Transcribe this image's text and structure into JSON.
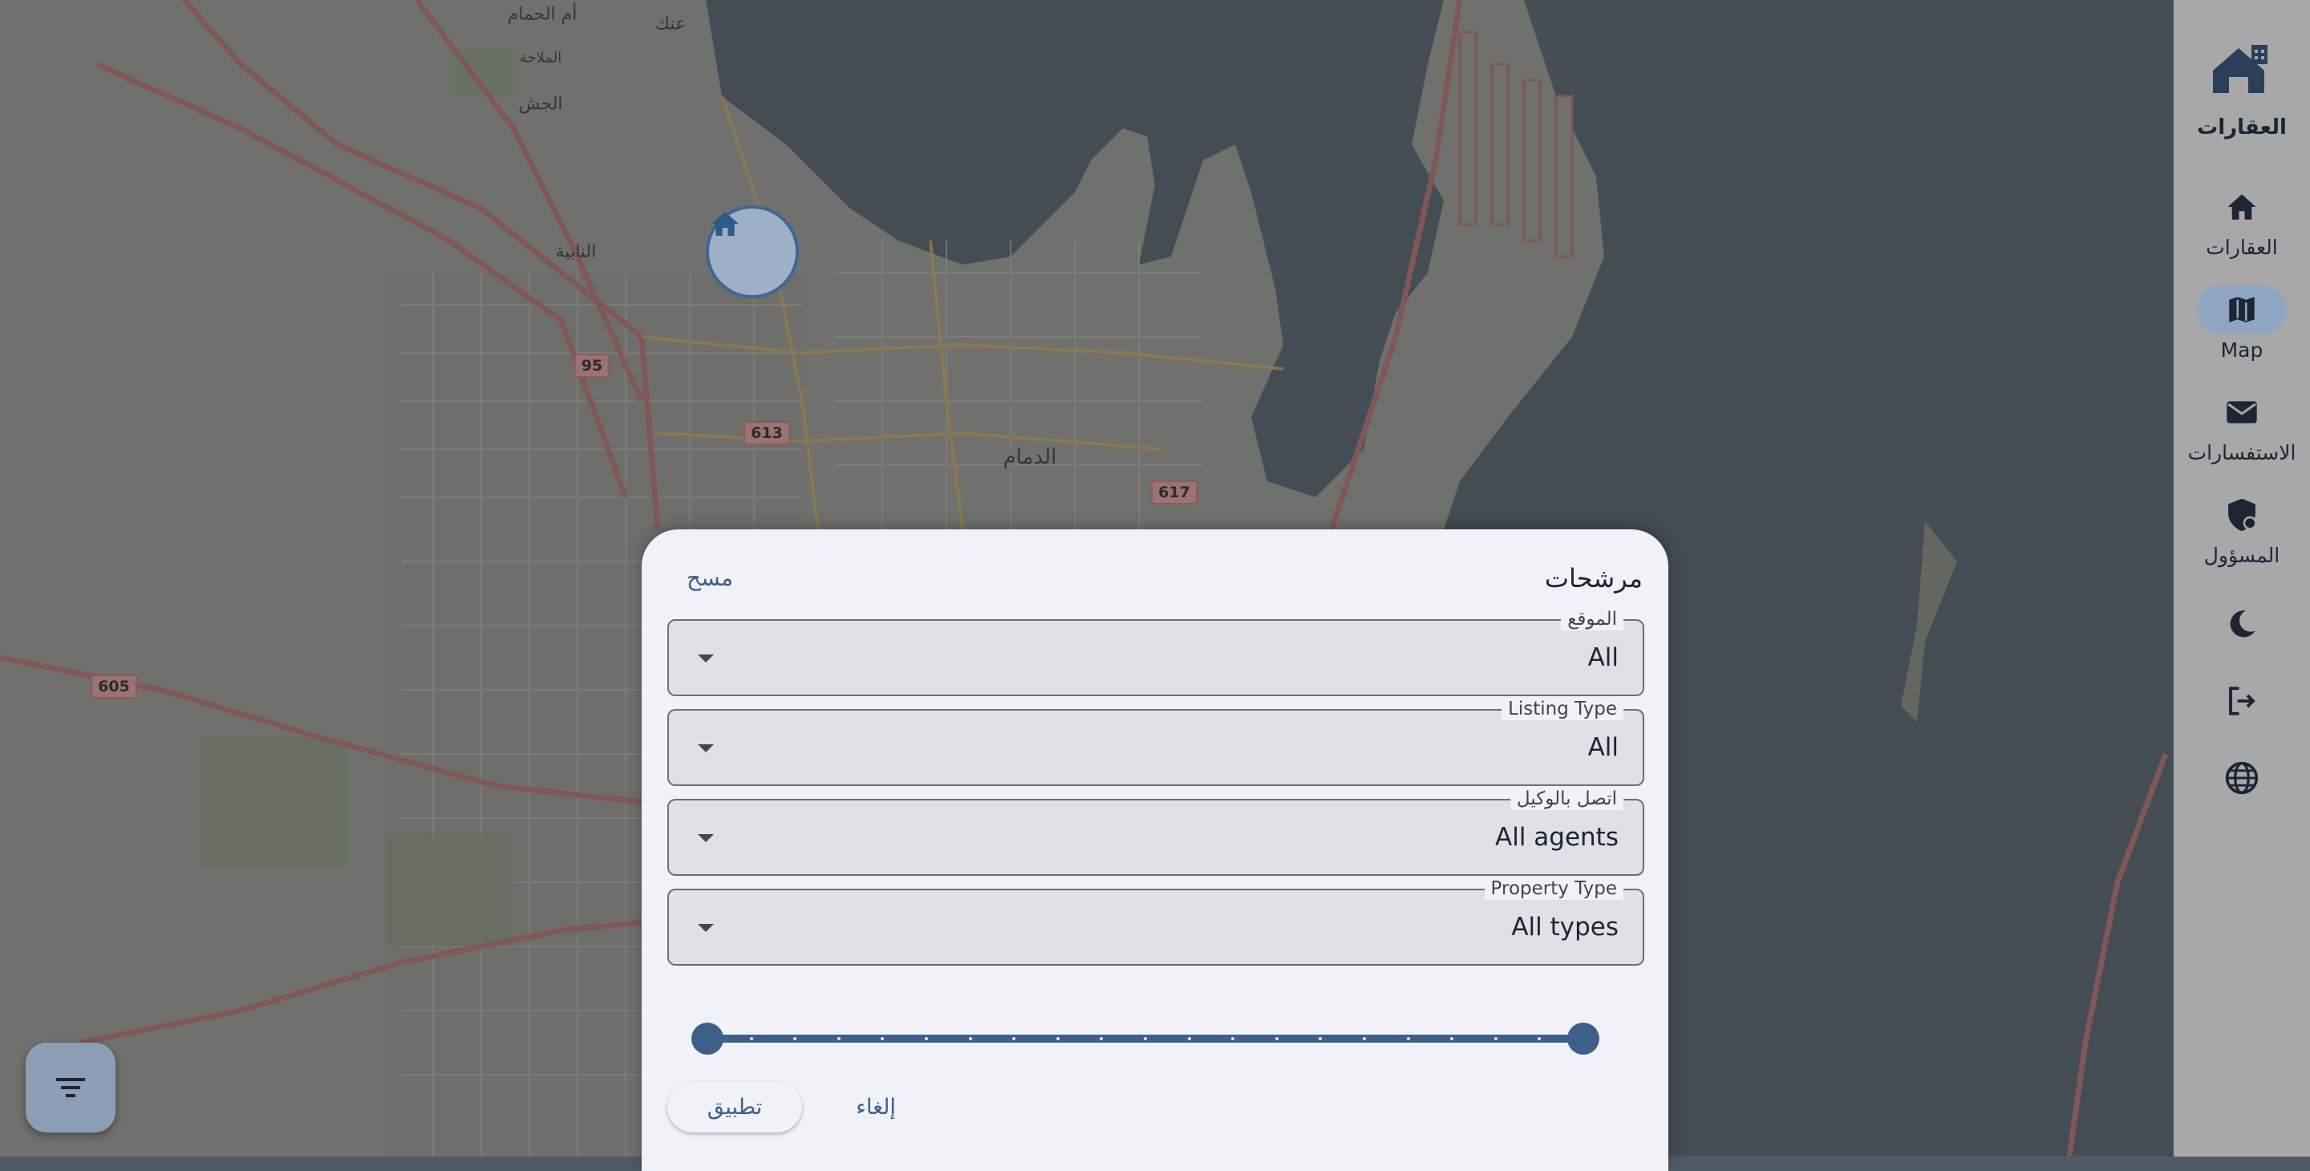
{
  "map": {
    "place_labels": [
      {
        "text": "أم الحمام",
        "name": "map-label-umm-alhamam"
      },
      {
        "text": "عنك",
        "name": "map-label-anak"
      },
      {
        "text": "الملاحة",
        "name": "map-label-almalaha"
      },
      {
        "text": "الجش",
        "name": "map-label-aljish"
      },
      {
        "text": "النابية",
        "name": "map-label-alnabiya"
      },
      {
        "text": "الدمام",
        "name": "map-label-dammam"
      }
    ],
    "road_shields": [
      "95",
      "613",
      "617",
      "605"
    ]
  },
  "rail": {
    "app_label": "العقارات",
    "items": [
      {
        "label": "العقارات",
        "icon": "home-icon"
      },
      {
        "label": "Map",
        "icon": "map-icon",
        "active": true
      },
      {
        "label": "الاستفسارات",
        "icon": "mail-icon"
      },
      {
        "label": "المسؤول",
        "icon": "admin-shield-icon"
      },
      {
        "label": "",
        "icon": "dark-mode-icon"
      },
      {
        "label": "",
        "icon": "logout-icon"
      },
      {
        "label": "",
        "icon": "language-globe-icon"
      }
    ]
  },
  "sheet": {
    "title": "مرشحات",
    "clear_label": "مسح",
    "fields": [
      {
        "label": "الموقع",
        "value": "All"
      },
      {
        "label": "Listing Type",
        "value": "All"
      },
      {
        "label": "اتصل بالوكيل",
        "value": "All agents"
      },
      {
        "label": "Property Type",
        "value": "All types"
      }
    ],
    "range_slider": {
      "min_fraction": 0,
      "max_fraction": 1,
      "tick_count": 21
    },
    "apply_label": "تطبيق",
    "cancel_label": "إلغاء"
  },
  "colors": {
    "primary": "#3d5f8a",
    "sheet_background": "#f0f2f7",
    "rail_background": "#a8a8a8",
    "water": "#4f5b66"
  }
}
